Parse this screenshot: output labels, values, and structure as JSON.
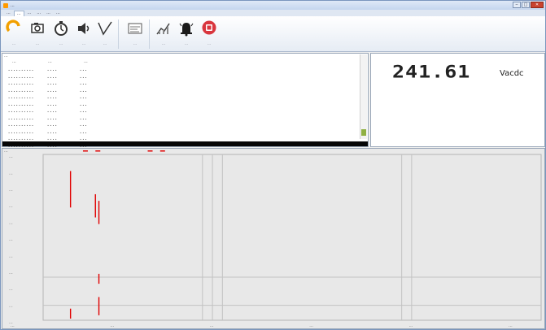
{
  "window": {
    "title": "..."
  },
  "menu_tabs": [
    "...",
    "...",
    "...",
    "...",
    "...",
    "..."
  ],
  "ribbon": [
    {
      "icon": "refresh-icon",
      "label": "..."
    },
    {
      "icon": "camera-icon",
      "label": "..."
    },
    {
      "icon": "stopwatch-icon",
      "label": "..."
    },
    {
      "icon": "volume-icon",
      "label": "..."
    },
    {
      "icon": "filter-icon",
      "label": "..."
    },
    {
      "icon": "log-icon",
      "label": "..."
    },
    {
      "icon": "chart-icon",
      "label": "..."
    },
    {
      "icon": "alarm-bell-icon",
      "label": "..."
    },
    {
      "icon": "stop-icon",
      "label": "..."
    }
  ],
  "data_grid": {
    "title": "...",
    "columns": [
      "...",
      "...",
      "..."
    ],
    "rows": [
      [
        "..........",
        "....",
        "..."
      ],
      [
        "..........",
        "....",
        "..."
      ],
      [
        "..........",
        "....",
        "..."
      ],
      [
        "..........",
        "....",
        "..."
      ],
      [
        "..........",
        "....",
        "..."
      ],
      [
        "..........",
        "....",
        "..."
      ],
      [
        "..........",
        "....",
        "..."
      ],
      [
        "..........",
        "....",
        "..."
      ],
      [
        "..........",
        "....",
        "..."
      ],
      [
        "..........",
        "....",
        "..."
      ],
      [
        "..........",
        "....",
        "..."
      ],
      [
        "..........",
        "....",
        "..."
      ]
    ]
  },
  "reading": {
    "value": "241.61",
    "unit": "Vacdc"
  },
  "colors": {
    "trace": "#e00000",
    "accent": "#f2a000",
    "stop": "#d9363e"
  },
  "chart_data": {
    "type": "line",
    "title": "...",
    "y_tick_labels": [
      "...",
      "...",
      "...",
      "...",
      "...",
      "...",
      "...",
      "...",
      "...",
      "...",
      "..."
    ],
    "x_tick_labels": [
      "...",
      "...",
      "...",
      "...",
      "...",
      "..."
    ],
    "series": [
      {
        "segments": [
          [
            0.74,
            0.91
          ],
          [
            0.91,
            0.99
          ],
          [
            0.72,
            0.91
          ],
          [
            0.91,
            0.98
          ]
        ]
      }
    ]
  }
}
